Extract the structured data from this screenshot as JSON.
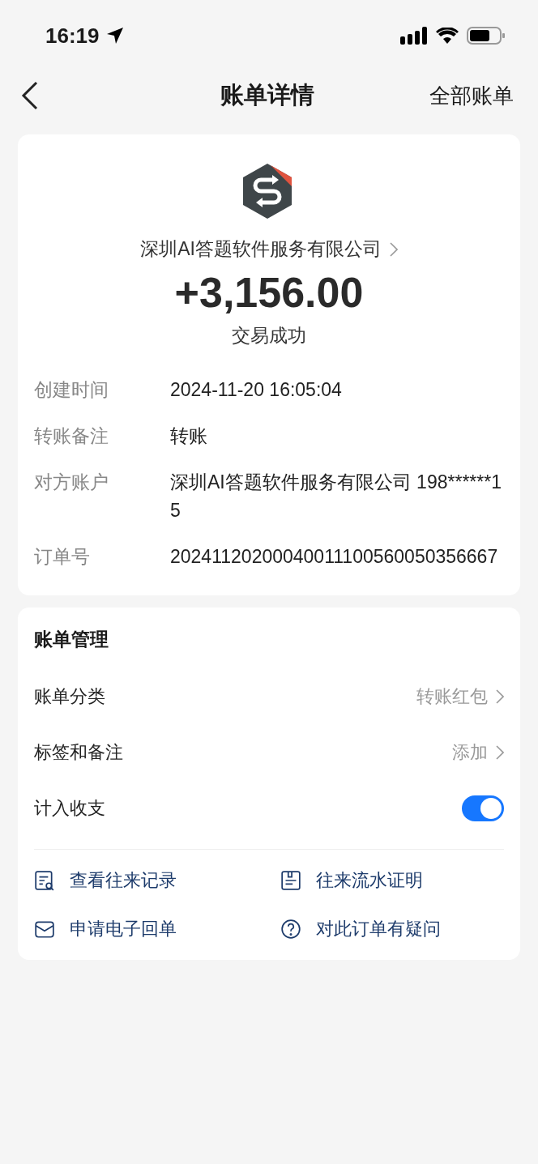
{
  "status_bar": {
    "time": "16:19"
  },
  "nav": {
    "title": "账单详情",
    "action": "全部账单"
  },
  "summary": {
    "merchant": "深圳AI答题软件服务有限公司",
    "amount": "+3,156.00",
    "status": "交易成功"
  },
  "details": [
    {
      "label": "创建时间",
      "value": "2024-11-20 16:05:04"
    },
    {
      "label": "转账备注",
      "value": "转账"
    },
    {
      "label": "对方账户",
      "value": "深圳AI答题软件服务有限公司 198******15"
    },
    {
      "label": "订单号",
      "value": "20241120200040011100560050356667"
    }
  ],
  "management": {
    "title": "账单管理",
    "rows": [
      {
        "kind": "link",
        "label": "账单分类",
        "value": "转账红包"
      },
      {
        "kind": "link",
        "label": "标签和备注",
        "value": "添加"
      },
      {
        "kind": "toggle",
        "label": "计入收支",
        "on": true
      }
    ],
    "actions": [
      {
        "kind": "records",
        "label": "查看往来记录"
      },
      {
        "kind": "statement",
        "label": "往来流水证明"
      },
      {
        "kind": "mail",
        "label": "申请电子回单"
      },
      {
        "kind": "question",
        "label": "对此订单有疑问"
      }
    ]
  }
}
